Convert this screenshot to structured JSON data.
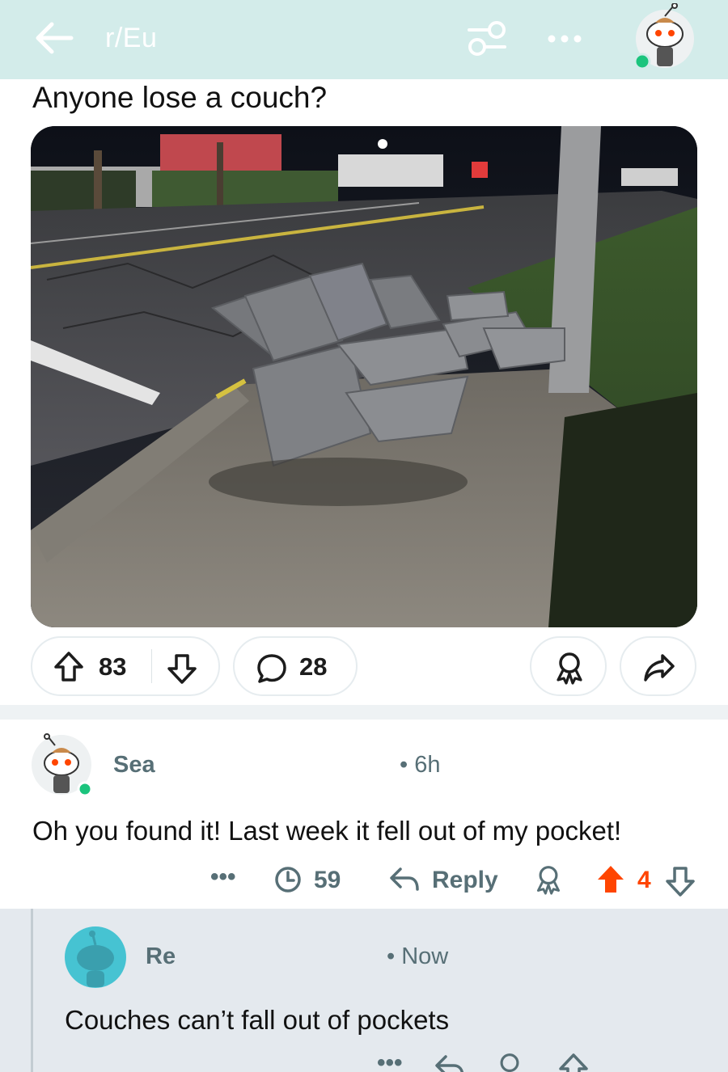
{
  "header": {
    "subreddit": "r/Eu",
    "background": "#d3ecea",
    "icons": [
      "back-arrow-icon",
      "filter-icon",
      "more-dots-icon",
      "user-avatar-icon"
    ]
  },
  "post": {
    "title": "Anyone lose a couch?",
    "image_alt": "gray reclining couch on a sidewalk at night",
    "upvotes": "83",
    "comments": "28"
  },
  "comment": {
    "username": "Sea",
    "time": "• 6h",
    "body": "Oh you found it! Last week it fell out of my pocket!",
    "more": "•••",
    "views": "59",
    "reply_label": "Reply",
    "score": "4",
    "upvote_color": "#ff4500"
  },
  "reply": {
    "username": "Re",
    "time": "• Now",
    "body": "Couches can’t fall out of pockets",
    "more": "•••",
    "avatar_color": "#46c3d2"
  }
}
